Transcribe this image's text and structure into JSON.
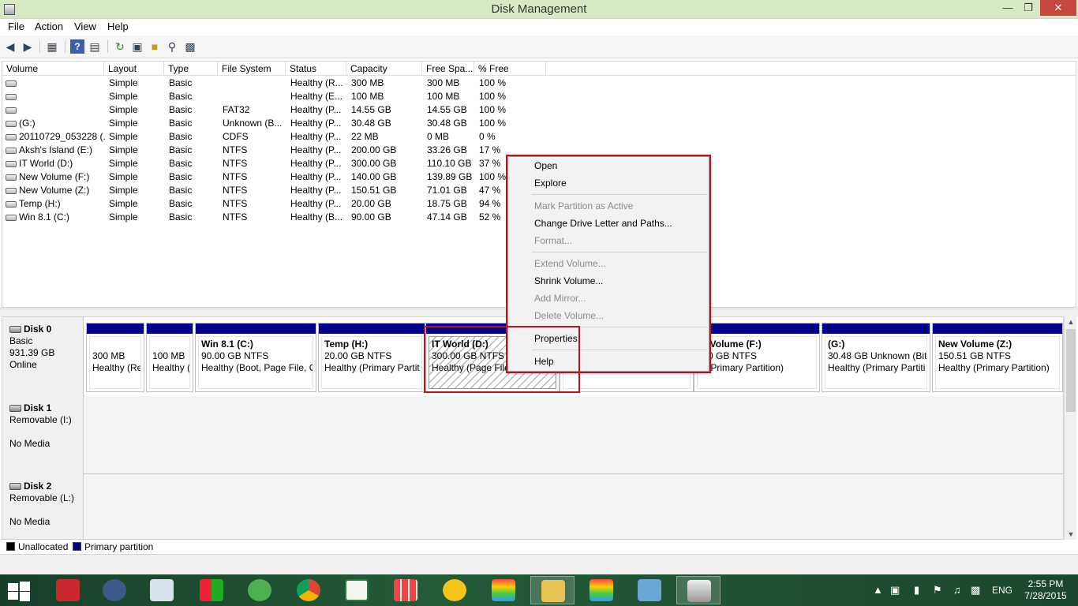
{
  "window": {
    "title": "Disk Management"
  },
  "menu": [
    "File",
    "Action",
    "View",
    "Help"
  ],
  "columns": [
    "Volume",
    "Layout",
    "Type",
    "File System",
    "Status",
    "Capacity",
    "Free Spa...",
    "% Free"
  ],
  "volumes": [
    [
      "",
      "Simple",
      "Basic",
      "",
      "Healthy (R...",
      "300 MB",
      "300 MB",
      "100 %"
    ],
    [
      "",
      "Simple",
      "Basic",
      "",
      "Healthy (E...",
      "100 MB",
      "100 MB",
      "100 %"
    ],
    [
      "",
      "Simple",
      "Basic",
      "FAT32",
      "Healthy (P...",
      "14.55 GB",
      "14.55 GB",
      "100 %"
    ],
    [
      "(G:)",
      "Simple",
      "Basic",
      "Unknown (B...",
      "Healthy (P...",
      "30.48 GB",
      "30.48 GB",
      "100 %"
    ],
    [
      "20110729_053228 (...",
      "Simple",
      "Basic",
      "CDFS",
      "Healthy (P...",
      "22 MB",
      "0 MB",
      "0 %"
    ],
    [
      "Aksh's Island (E:)",
      "Simple",
      "Basic",
      "NTFS",
      "Healthy (P...",
      "200.00 GB",
      "33.26 GB",
      "17 %"
    ],
    [
      "IT World (D:)",
      "Simple",
      "Basic",
      "NTFS",
      "Healthy (P...",
      "300.00 GB",
      "110.10 GB",
      "37 %"
    ],
    [
      "New Volume (F:)",
      "Simple",
      "Basic",
      "NTFS",
      "Healthy (P...",
      "140.00 GB",
      "139.89 GB",
      "100 %"
    ],
    [
      "New Volume (Z:)",
      "Simple",
      "Basic",
      "NTFS",
      "Healthy (P...",
      "150.51 GB",
      "71.01 GB",
      "47 %"
    ],
    [
      "Temp (H:)",
      "Simple",
      "Basic",
      "NTFS",
      "Healthy (P...",
      "20.00 GB",
      "18.75 GB",
      "94 %"
    ],
    [
      "Win 8.1 (C:)",
      "Simple",
      "Basic",
      "NTFS",
      "Healthy (B...",
      "90.00 GB",
      "47.14 GB",
      "52 %"
    ]
  ],
  "disks": [
    {
      "name": "Disk 0",
      "type": "Basic",
      "size": "931.39 GB",
      "status": "Online"
    },
    {
      "name": "Disk 1",
      "type": "Removable (I:)",
      "size": "",
      "status": "No Media"
    },
    {
      "name": "Disk 2",
      "type": "Removable (L:)",
      "size": "",
      "status": "No Media"
    }
  ],
  "partitions": [
    {
      "name": "",
      "size": "300 MB",
      "status": "Healthy (Re"
    },
    {
      "name": "",
      "size": "100 MB",
      "status": "Healthy ("
    },
    {
      "name": "Win 8.1  (C:)",
      "size": "90.00 GB NTFS",
      "status": "Healthy (Boot, Page File, C"
    },
    {
      "name": "Temp  (H:)",
      "size": "20.00 GB NTFS",
      "status": "Healthy (Primary Partit"
    },
    {
      "name": "IT World  (D:)",
      "size": "300.00 GB NTFS",
      "status": "Healthy (Page File"
    },
    {
      "name": "",
      "size": "",
      "status": ""
    },
    {
      "name": "w Volume  (F:)",
      "size": ".00 GB NTFS",
      "status": "y (Primary Partition)"
    },
    {
      "name": "(G:)",
      "size": "30.48 GB Unknown (BitL",
      "status": "Healthy (Primary Partiti"
    },
    {
      "name": "New Volume  (Z:)",
      "size": "150.51 GB NTFS",
      "status": "Healthy (Primary Partition)"
    }
  ],
  "legend": [
    "Unallocated",
    "Primary partition"
  ],
  "context_menu": [
    {
      "label": "Open",
      "enabled": true
    },
    {
      "label": "Explore",
      "enabled": true
    },
    {
      "label": "Mark Partition as Active",
      "enabled": false
    },
    {
      "label": "Change Drive Letter and Paths...",
      "enabled": true
    },
    {
      "label": "Format...",
      "enabled": false
    },
    {
      "label": "Extend Volume...",
      "enabled": false
    },
    {
      "label": "Shrink Volume...",
      "enabled": true
    },
    {
      "label": "Add Mirror...",
      "enabled": false
    },
    {
      "label": "Delete Volume...",
      "enabled": false
    },
    {
      "label": "Properties",
      "enabled": true
    },
    {
      "label": "Help",
      "enabled": true
    }
  ],
  "taskbar": {
    "language": "ENG",
    "time": "2:55 PM",
    "date": "7/28/2015"
  },
  "colors": {
    "titlebar": "#d7e8c4",
    "primary_partition": "#00008a",
    "highlight": "#c0101c",
    "close": "#c7463e"
  },
  "icons": [
    "back-icon",
    "forward-icon",
    "console-tree-icon",
    "help-icon",
    "show-pane-icon",
    "refresh-icon",
    "rescan-icon",
    "open-icon",
    "search-icon",
    "properties-icon"
  ]
}
